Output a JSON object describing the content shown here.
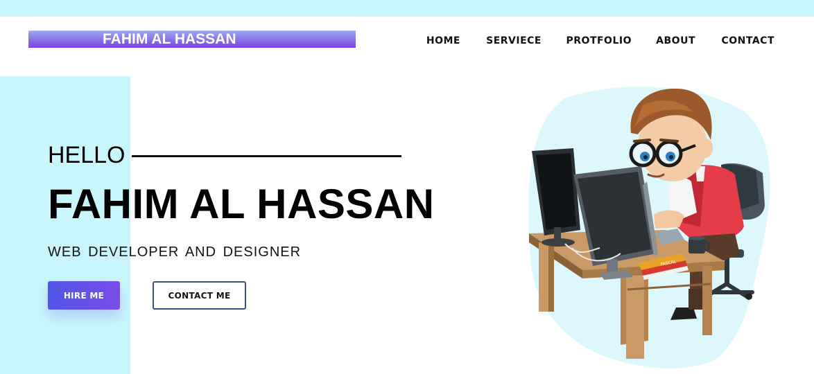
{
  "header": {
    "logo_text": "FAHIM AL HASSAN",
    "nav": [
      {
        "label": "HOME"
      },
      {
        "label": "SERVIECE"
      },
      {
        "label": "PROTFOLIO"
      },
      {
        "label": "ABOUT"
      },
      {
        "label": "CONTACT"
      }
    ]
  },
  "hero": {
    "greeting": "HELLO",
    "name": "FAHIM AL HASSAN",
    "role": "WEB DEVELOPER AND DESIGNER",
    "hire_label": "HIRE ME",
    "contact_label": "CONTACT ME"
  },
  "illustration": {
    "icon": "developer-at-desk-illustration",
    "book_text": "PASCAL"
  },
  "colors": {
    "accent_strip": "#c8f6fc",
    "button_gradient_start": "#4f56e6",
    "button_gradient_end": "#7b4ce8",
    "outline_button_border": "#3d4f86"
  }
}
